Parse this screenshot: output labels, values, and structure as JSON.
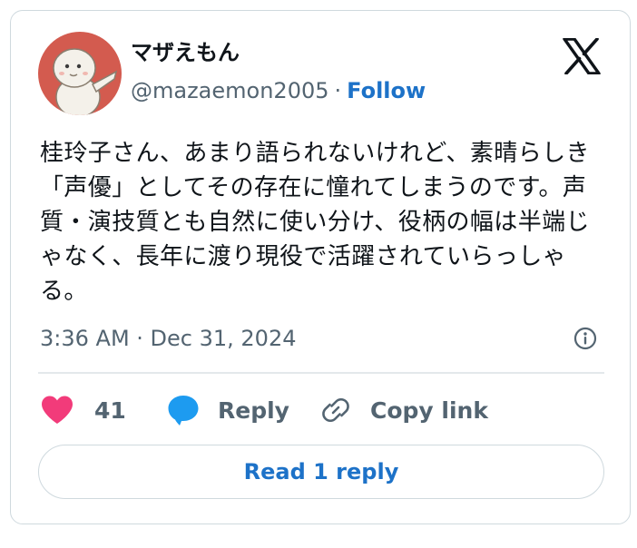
{
  "author": {
    "display_name": "マザえもん",
    "handle": "@mazaemon2005",
    "separator": "·",
    "follow_label": "Follow"
  },
  "tweet": {
    "text": "桂玲子さん、あまり語られないけれど、素晴らしき「声優」としてその存在に憧れてしまうのです。声質・演技質とも自然に使い分け、役柄の幅は半端じゃなく、長年に渡り現役で活躍されていらっしゃる。",
    "timestamp": "3:36 AM · Dec 31, 2024"
  },
  "actions": {
    "like_count": "41",
    "reply_label": "Reply",
    "copy_link_label": "Copy link"
  },
  "read_replies_label": "Read 1 reply",
  "icons": {
    "platform": "x-logo-icon",
    "like": "heart-icon",
    "reply": "speech-bubble-icon",
    "copy": "link-icon",
    "info": "info-icon"
  },
  "colors": {
    "accent": "#1d72c8",
    "like": "#f23b7a",
    "reply": "#1d9bf0",
    "muted": "#536471",
    "text": "#0f1419",
    "avatar_bg": "#d35b4f"
  }
}
